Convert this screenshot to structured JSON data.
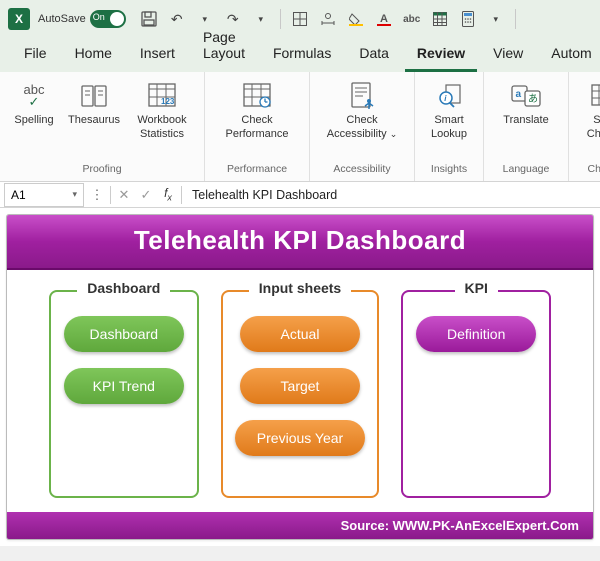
{
  "titlebar": {
    "autosave_label": "AutoSave",
    "autosave_state": "On"
  },
  "tabs": {
    "file": "File",
    "home": "Home",
    "insert": "Insert",
    "page_layout": "Page Layout",
    "formulas": "Formulas",
    "data": "Data",
    "review": "Review",
    "view": "View",
    "automate": "Autom"
  },
  "ribbon": {
    "spelling": "Spelling",
    "thesaurus": "Thesaurus",
    "workbook_stats": "Workbook Statistics",
    "proofing_group": "Proofing",
    "check_perf": "Check Performance",
    "performance_group": "Performance",
    "check_access": "Check Accessibility",
    "accessibility_group": "Accessibility",
    "smart_lookup": "Smart Lookup",
    "insights_group": "Insights",
    "translate": "Translate",
    "language_group": "Language",
    "show_changes": "Sho Chang",
    "changes_group": "Chang"
  },
  "formulabar": {
    "cell_ref": "A1",
    "formula_value": "Telehealth KPI Dashboard"
  },
  "dashboard": {
    "title": "Telehealth KPI Dashboard",
    "panel1_title": "Dashboard",
    "panel1_btn1": "Dashboard",
    "panel1_btn2": "KPI Trend",
    "panel2_title": "Input sheets",
    "panel2_btn1": "Actual",
    "panel2_btn2": "Target",
    "panel2_btn3": "Previous Year",
    "panel3_title": "KPI",
    "panel3_btn1": "Definition",
    "footer": "Source: WWW.PK-AnExcelExpert.Com"
  }
}
